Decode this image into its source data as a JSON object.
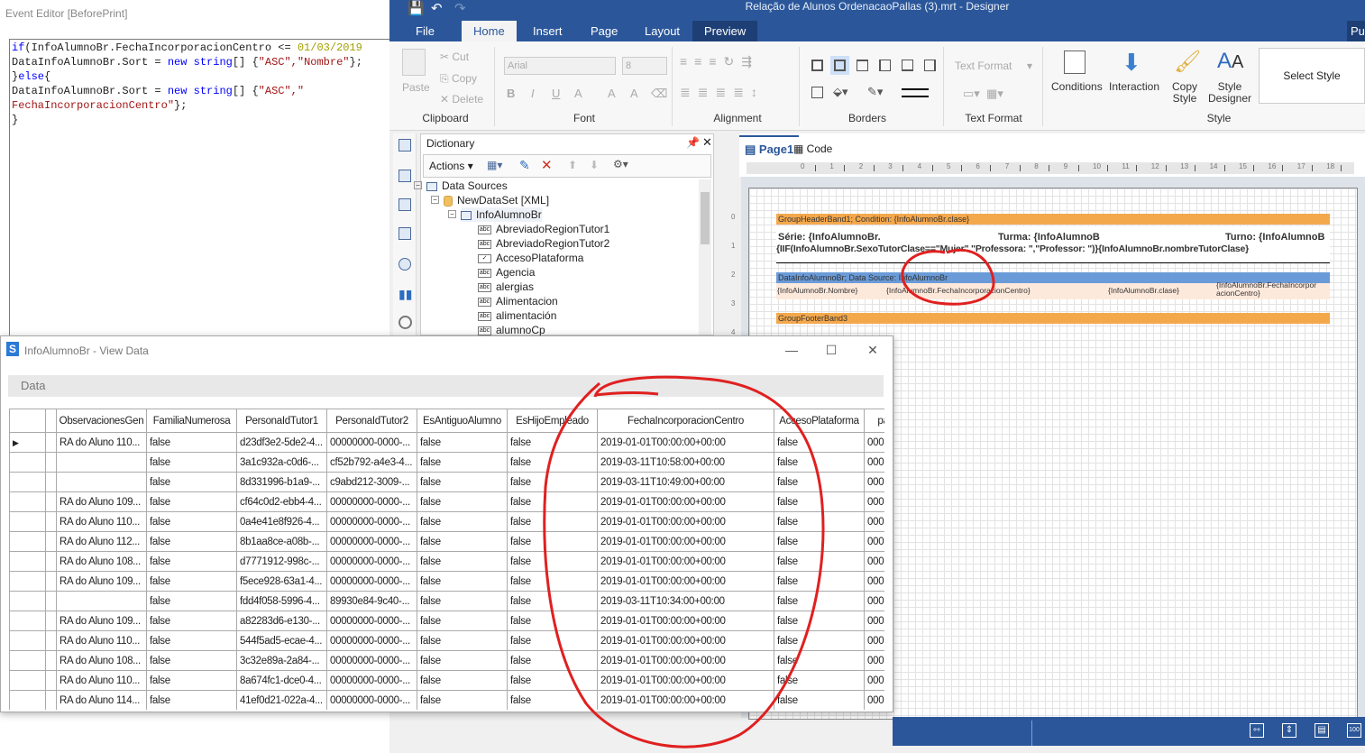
{
  "event_editor": {
    "title": "Event Editor [BeforePrint]",
    "code_lines": [
      [
        [
          "kw",
          "if"
        ],
        [
          "",
          "(InfoAlumnoBr.FechaIncorporacionCentro <= "
        ],
        [
          "num",
          "01/03/2019"
        ]
      ],
      [
        [
          "",
          "DataInfoAlumnoBr.Sort = "
        ],
        [
          "kw",
          "new"
        ],
        [
          "",
          " "
        ],
        [
          "kw",
          "string"
        ],
        [
          "",
          "[] {"
        ],
        [
          "str",
          "\"ASC\",\"Nombre\""
        ],
        [
          "",
          "};"
        ]
      ],
      [
        [
          "",
          "}"
        ],
        [
          "kw",
          "else"
        ],
        [
          "",
          "{"
        ]
      ],
      [
        [
          "",
          "DataInfoAlumnoBr.Sort = "
        ],
        [
          "kw",
          "new"
        ],
        [
          "",
          " "
        ],
        [
          "kw",
          "string"
        ],
        [
          "",
          "[] {"
        ],
        [
          "str",
          "\"ASC\",\""
        ]
      ],
      [
        [
          "str",
          "FechaIncorporacionCentro\""
        ],
        [
          "",
          "};"
        ]
      ],
      [
        [
          "",
          "}"
        ]
      ]
    ]
  },
  "designer": {
    "title": "Relação de Alunos OrdenacaoPallas (3).mrt - Designer",
    "tabs": [
      "File",
      "Home",
      "Insert",
      "Page",
      "Layout",
      "Preview"
    ],
    "active_tab": "Home",
    "tab_right_cut": "Pu",
    "ribbon": {
      "clipboard": {
        "label": "Clipboard",
        "paste": "Paste",
        "cut": "Cut",
        "copy": "Copy",
        "delete": "Delete"
      },
      "font": {
        "label": "Font",
        "family": "Arial",
        "size": "8",
        "bold": "B",
        "italic": "I",
        "underline": "U",
        "color": "A",
        "grow": "A",
        "shrink": "A"
      },
      "alignment": {
        "label": "Alignment"
      },
      "borders": {
        "label": "Borders"
      },
      "text_format": {
        "label": "Text Format",
        "combo": "Text Format"
      },
      "style": {
        "label": "Style",
        "conditions": "Conditions",
        "interaction": "Interaction",
        "copy_style": "Copy Style",
        "style_designer": "Style Designer",
        "select_style": "Select Style"
      }
    },
    "dictionary": {
      "title": "Dictionary",
      "actions": "Actions",
      "tree": [
        {
          "label": "Data Sources",
          "level": 0,
          "icon": "table-icon"
        },
        {
          "label": "NewDataSet [XML]",
          "level": 1,
          "icon": "database-icon"
        },
        {
          "label": "InfoAlumnoBr",
          "level": 2,
          "icon": "table-icon"
        },
        {
          "label": "AbreviadoRegionTutor1",
          "level": 3,
          "icon": "abc-icon"
        },
        {
          "label": "AbreviadoRegionTutor2",
          "level": 3,
          "icon": "abc-icon"
        },
        {
          "label": "AccesoPlataforma",
          "level": 3,
          "icon": "checkbox-icon"
        },
        {
          "label": "Agencia",
          "level": 3,
          "icon": "abc-icon"
        },
        {
          "label": "alergias",
          "level": 3,
          "icon": "abc-icon"
        },
        {
          "label": "Alimentacion",
          "level": 3,
          "icon": "abc-icon"
        },
        {
          "label": "alimentación",
          "level": 3,
          "icon": "abc-icon"
        },
        {
          "label": "alumnoCp",
          "level": 3,
          "icon": "abc-icon"
        }
      ]
    },
    "report_tabs": [
      "Page1",
      "Code"
    ],
    "ruler": [
      "0",
      "1",
      "2",
      "3",
      "4",
      "5",
      "6",
      "7",
      "8",
      "9",
      "10",
      "11",
      "12",
      "13",
      "14",
      "15",
      "16",
      "17",
      "18"
    ],
    "vruler": [
      "0",
      "1",
      "2",
      "3",
      "4"
    ],
    "bands": {
      "group_header": "GroupHeaderBand1; Condition: {InfoAlumnoBr.clase}",
      "serie": "Série: {InfoAlumnoBr.",
      "turma": "Turma: {InfoAlumnoB",
      "turno": "Turno: {InfoAlumnoB",
      "iif": "{IIF(InfoAlumnoBr.SexoTutorClase==\"Mujer\",\"Professora: \",\"Professor: \")}{InfoAlumnoBr.nombreTutorClase}",
      "data_band": "DataInfoAlumnoBr; Data Source: InfoAlumnoBr",
      "field_nombre": "{InfoAlumnoBr.Nombre}",
      "field_fecha": "{InfoAlumnoBr.FechaIncorporacionCentro}",
      "field_clase": "{InfoAlumnoBr.clase}",
      "field_fecha2": "{InfoAlumnoBr.FechaIncorpor acionCentro}",
      "group_footer": "GroupFooterBand3"
    },
    "status_icons": [
      "fit-width-icon",
      "fit-height-icon",
      "whole-page-icon",
      "zoom-100-icon"
    ],
    "status_zoom_label": "100"
  },
  "view_data": {
    "title": "InfoAlumnoBr - View Data",
    "section": "Data",
    "columns": [
      "ObservacionesGen",
      "FamiliaNumerosa",
      "PersonaIdTutor1",
      "PersonaIdTutor2",
      "EsAntiguoAlumno",
      "EsHijoEmpleado",
      "FechaIncorporacionCentro",
      "AccesoPlataforma",
      "pa"
    ],
    "rows": [
      [
        "RA do Aluno 110...",
        "false",
        "d23df3e2-5de2-4...",
        "00000000-0000-...",
        "false",
        "false",
        "2019-01-01T00:00:00+00:00",
        "false",
        "000"
      ],
      [
        "",
        "false",
        "3a1c932a-c0d6-...",
        "cf52b792-a4e3-4...",
        "false",
        "false",
        "2019-03-11T10:58:00+00:00",
        "false",
        "000"
      ],
      [
        "",
        "false",
        "8d331996-b1a9-...",
        "c9abd212-3009-...",
        "false",
        "false",
        "2019-03-11T10:49:00+00:00",
        "false",
        "000"
      ],
      [
        "RA do Aluno 109...",
        "false",
        "cf64c0d2-ebb4-4...",
        "00000000-0000-...",
        "false",
        "false",
        "2019-01-01T00:00:00+00:00",
        "false",
        "000"
      ],
      [
        "RA do Aluno 110...",
        "false",
        "0a4e41e8f926-4...",
        "00000000-0000-...",
        "false",
        "false",
        "2019-01-01T00:00:00+00:00",
        "false",
        "000"
      ],
      [
        "RA do Aluno 112...",
        "false",
        "8b1aa8ce-a08b-...",
        "00000000-0000-...",
        "false",
        "false",
        "2019-01-01T00:00:00+00:00",
        "false",
        "000"
      ],
      [
        "RA do Aluno 108...",
        "false",
        "d7771912-998c-...",
        "00000000-0000-...",
        "false",
        "false",
        "2019-01-01T00:00:00+00:00",
        "false",
        "000"
      ],
      [
        "RA do Aluno 109...",
        "false",
        "f5ece928-63a1-4...",
        "00000000-0000-...",
        "false",
        "false",
        "2019-01-01T00:00:00+00:00",
        "false",
        "000"
      ],
      [
        "",
        "false",
        "fdd4f058-5996-4...",
        "89930e84-9c40-...",
        "false",
        "false",
        "2019-03-11T10:34:00+00:00",
        "false",
        "000"
      ],
      [
        "RA do Aluno 109...",
        "false",
        "a82283d6-e130-...",
        "00000000-0000-...",
        "false",
        "false",
        "2019-01-01T00:00:00+00:00",
        "false",
        "000"
      ],
      [
        "RA do Aluno 110...",
        "false",
        "544f5ad5-ecae-4...",
        "00000000-0000-...",
        "false",
        "false",
        "2019-01-01T00:00:00+00:00",
        "false",
        "000"
      ],
      [
        "RA do Aluno 108...",
        "false",
        "3c32e89a-2a84-...",
        "00000000-0000-...",
        "false",
        "false",
        "2019-01-01T00:00:00+00:00",
        "false",
        "000"
      ],
      [
        "RA do Aluno 110...",
        "false",
        "8a674fc1-dce0-4...",
        "00000000-0000-...",
        "false",
        "false",
        "2019-01-01T00:00:00+00:00",
        "false",
        "000"
      ],
      [
        "RA do Aluno 114...",
        "false",
        "41ef0d21-022a-4...",
        "00000000-0000-...",
        "false",
        "false",
        "2019-01-01T00:00:00+00:00",
        "false",
        "000"
      ]
    ],
    "current_row_marker": "▶"
  },
  "colors": {
    "ribbon_blue": "#2b579a",
    "band_orange": "#f4a84c",
    "band_blue": "#6a9bd8",
    "annotation_red": "#e02020"
  }
}
